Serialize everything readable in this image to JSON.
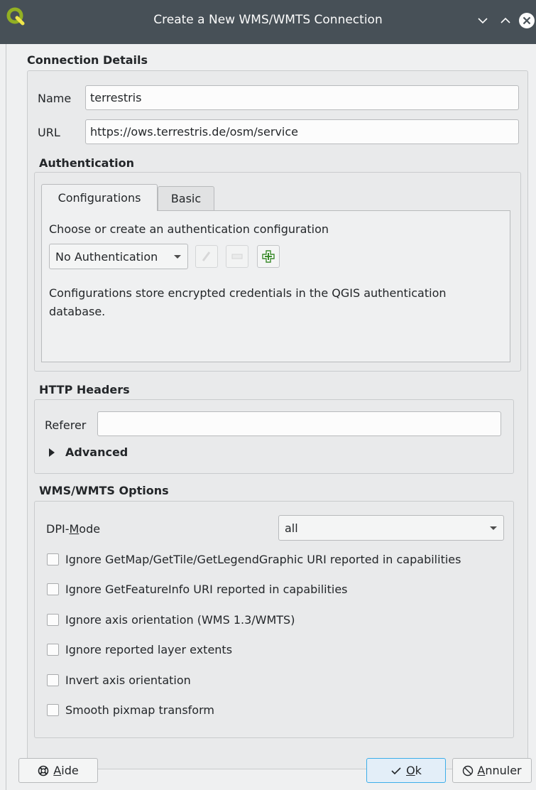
{
  "window": {
    "title": "Create a New WMS/WMTS Connection",
    "icons": {
      "app": "qgis-logo-icon",
      "minimize": "chevron-down-icon",
      "maximize": "chevron-up-icon",
      "close": "close-icon"
    }
  },
  "connection": {
    "section_title": "Connection Details",
    "name_label": "Name",
    "name_value": "terrestris",
    "url_label": "URL",
    "url_value": "https://ows.terrestris.de/osm/service"
  },
  "authentication": {
    "section_title": "Authentication",
    "tabs": [
      "Configurations",
      "Basic"
    ],
    "active_tab": "Configurations",
    "choose_text": "Choose or create an authentication configuration",
    "combo_value": "No Authentication",
    "info_text": "Configurations store encrypted credentials in the QGIS authentication database.",
    "icons": {
      "edit": "pencil-icon",
      "remove": "minus-icon",
      "add": "plus-icon"
    }
  },
  "http_headers": {
    "section_title": "HTTP Headers",
    "referer_label": "Referer",
    "referer_value": "",
    "advanced_label": "Advanced"
  },
  "wms_options": {
    "section_title": "WMS/WMTS Options",
    "dpi_label_prefix": "DPI-",
    "dpi_label_mnemonic": "M",
    "dpi_label_suffix": "ode",
    "dpi_value": "all",
    "checkboxes": [
      {
        "label": "Ignore GetMap/GetTile/GetLegendGraphic URI reported in capabilities",
        "checked": false
      },
      {
        "label": "Ignore GetFeatureInfo URI reported in capabilities",
        "checked": false
      },
      {
        "label": "Ignore axis orientation (WMS 1.3/WMTS)",
        "checked": false
      },
      {
        "label": "Ignore reported layer extents",
        "checked": false
      },
      {
        "label": "Invert axis orientation",
        "checked": false
      },
      {
        "label": "Smooth pixmap transform",
        "checked": false
      }
    ]
  },
  "buttons": {
    "help_mnemonic": "A",
    "help_rest": "ide",
    "ok_mnemonic": "O",
    "ok_rest": "k",
    "cancel_mnemonic": "A",
    "cancel_rest": "nnuler",
    "icons": {
      "help": "lifebuoy-icon",
      "ok": "checkmark-icon",
      "cancel": "cancel-circle-icon"
    }
  },
  "colors": {
    "titlebar": "#475057",
    "accent": "#3daee9",
    "background": "#eff0f1"
  }
}
